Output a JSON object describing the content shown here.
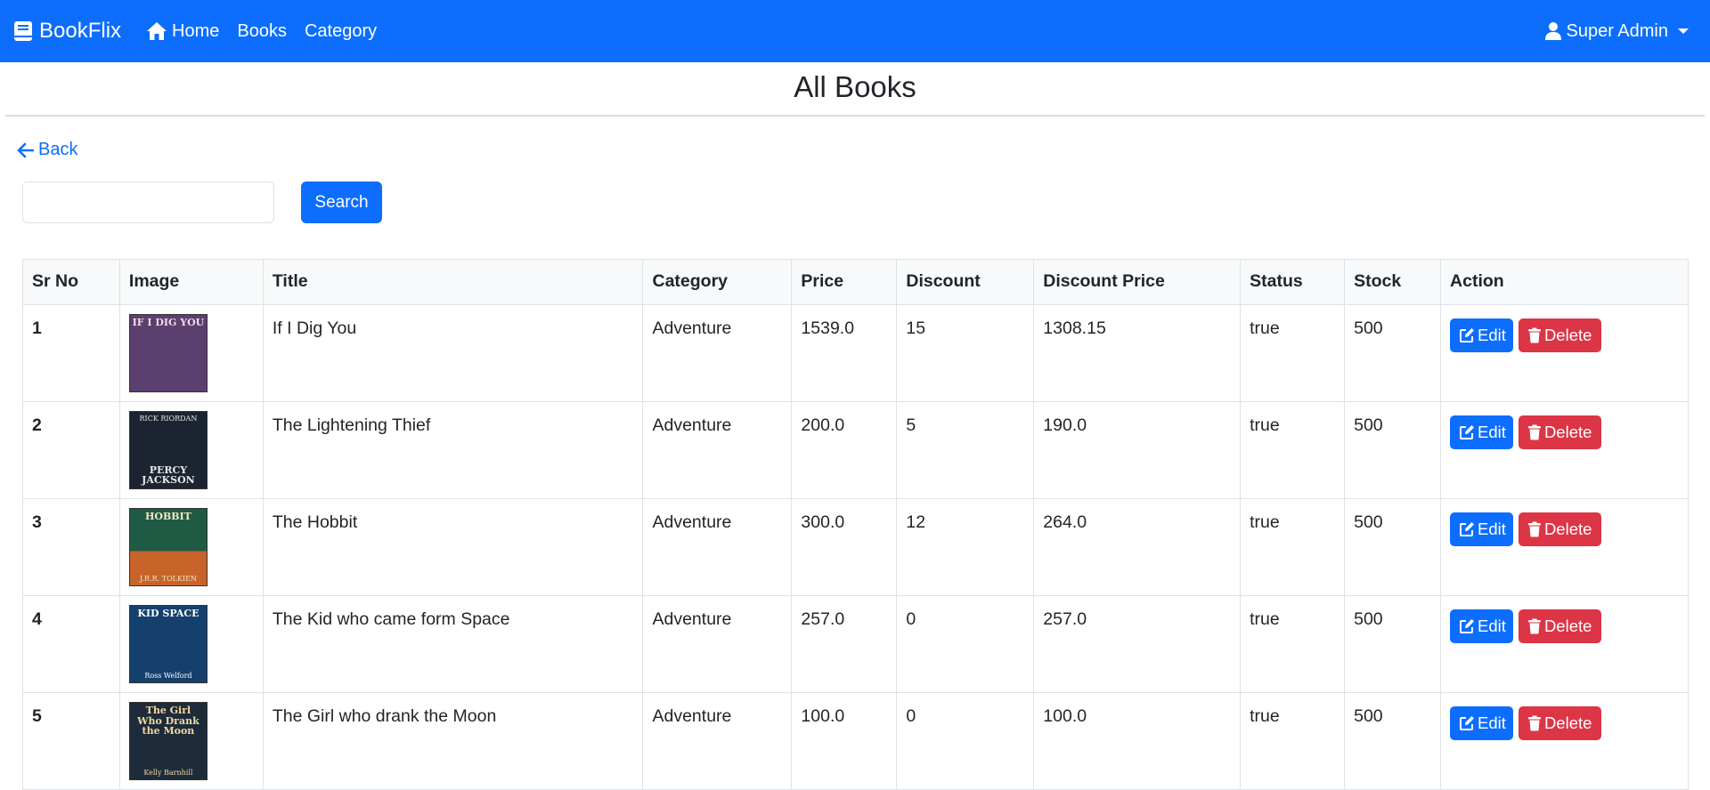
{
  "navbar": {
    "brand": "BookFlix",
    "links": {
      "home": "Home",
      "books": "Books",
      "category": "Category"
    },
    "user": "Super Admin",
    "color": "#0d6efd"
  },
  "page": {
    "title": "All Books",
    "back": "Back"
  },
  "search": {
    "value": "",
    "button": "Search"
  },
  "table": {
    "headers": [
      "Sr No",
      "Image",
      "Title",
      "Category",
      "Price",
      "Discount",
      "Discount Price",
      "Status",
      "Stock",
      "Action"
    ],
    "rows": [
      {
        "sr": "1",
        "title": "If I Dig You",
        "category": "Adventure",
        "price": "1539.0",
        "discount": "15",
        "discount_price": "1308.15",
        "status": "true",
        "stock": "500",
        "cover": {
          "text": "IF I DIG YOU",
          "author": "",
          "bg": "#5b3f6e",
          "fg": "#f5d9e8"
        }
      },
      {
        "sr": "2",
        "title": "The Lightening Thief",
        "category": "Adventure",
        "price": "200.0",
        "discount": "5",
        "discount_price": "190.0",
        "status": "true",
        "stock": "500",
        "cover": {
          "text": "PERCY JACKSON",
          "author": "RICK RIORDAN",
          "bg": "#1b2430",
          "fg": "#e8e8e8"
        }
      },
      {
        "sr": "3",
        "title": "The Hobbit",
        "category": "Adventure",
        "price": "300.0",
        "discount": "12",
        "discount_price": "264.0",
        "status": "true",
        "stock": "500",
        "cover": {
          "text": "HOBBIT",
          "author": "J.R.R. TOLKIEN",
          "bg": "#1f5a44",
          "fg": "#f3e7c2"
        }
      },
      {
        "sr": "4",
        "title": "The Kid who came form Space",
        "category": "Adventure",
        "price": "257.0",
        "discount": "0",
        "discount_price": "257.0",
        "status": "true",
        "stock": "500",
        "cover": {
          "text": "KID SPACE",
          "author": "Ross Welford",
          "bg": "#15406e",
          "fg": "#ffffff"
        }
      },
      {
        "sr": "5",
        "title": "The Girl who drank the Moon",
        "category": "Adventure",
        "price": "100.0",
        "discount": "0",
        "discount_price": "100.0",
        "status": "true",
        "stock": "500",
        "cover": {
          "text": "The Girl Who Drank the Moon",
          "author": "Kelly Barnhill",
          "bg": "#1d2b3a",
          "fg": "#f0d9a0"
        }
      }
    ],
    "edit_label": "Edit",
    "delete_label": "Delete"
  }
}
